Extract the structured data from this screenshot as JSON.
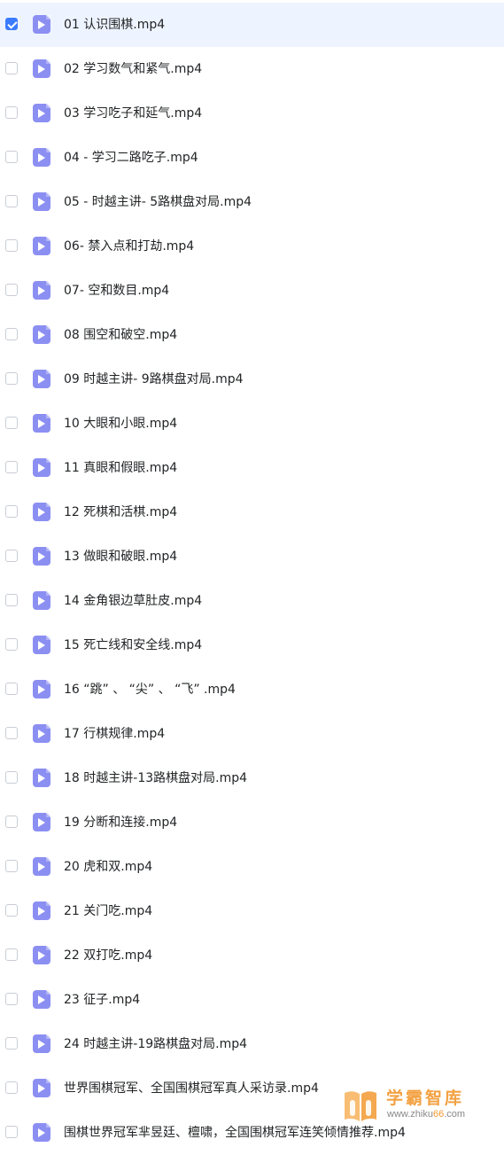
{
  "files": [
    {
      "name": "01 认识围棋.mp4",
      "checked": true
    },
    {
      "name": "02  学习数气和紧气.mp4",
      "checked": false
    },
    {
      "name": "03  学习吃子和延气.mp4",
      "checked": false
    },
    {
      "name": "04 - 学习二路吃子.mp4",
      "checked": false
    },
    {
      "name": "05 - 时越主讲- 5路棋盘对局.mp4",
      "checked": false
    },
    {
      "name": "06- 禁入点和打劫.mp4",
      "checked": false
    },
    {
      "name": "07- 空和数目.mp4",
      "checked": false
    },
    {
      "name": "08  围空和破空.mp4",
      "checked": false
    },
    {
      "name": "09  时越主讲- 9路棋盘对局.mp4",
      "checked": false
    },
    {
      "name": "10  大眼和小眼.mp4",
      "checked": false
    },
    {
      "name": "11 真眼和假眼.mp4",
      "checked": false
    },
    {
      "name": "12 死棋和活棋.mp4",
      "checked": false
    },
    {
      "name": "13  做眼和破眼.mp4",
      "checked": false
    },
    {
      "name": "14 金角银边草肚皮.mp4",
      "checked": false
    },
    {
      "name": "15 死亡线和安全线.mp4",
      "checked": false
    },
    {
      "name": "16  “跳” 、 “尖” 、 “飞” .mp4",
      "checked": false
    },
    {
      "name": "17  行棋规律.mp4",
      "checked": false
    },
    {
      "name": "18  时越主讲-13路棋盘对局.mp4",
      "checked": false
    },
    {
      "name": "19  分断和连接.mp4",
      "checked": false
    },
    {
      "name": "20  虎和双.mp4",
      "checked": false
    },
    {
      "name": "21  关门吃.mp4",
      "checked": false
    },
    {
      "name": "22  双打吃.mp4",
      "checked": false
    },
    {
      "name": "23  征子.mp4",
      "checked": false
    },
    {
      "name": "24  时越主讲-19路棋盘对局.mp4",
      "checked": false
    },
    {
      "name": "世界围棋冠军、全国围棋冠军真人采访录.mp4",
      "checked": false
    },
    {
      "name": "围棋世界冠军芈昱廷、檀啸，全国围棋冠军连笑倾情推荐.mp4",
      "checked": false
    }
  ],
  "icons": {
    "checkbox": "checkbox-icon",
    "file": "video-file-icon"
  },
  "colors": {
    "accent": "#3a7bfd",
    "selected_row": "#eef4ff",
    "file_icon": "#8c8ff2",
    "watermark": "#f29a33"
  },
  "watermark": {
    "title": "学霸智库",
    "url_prefix": "www.zhiku",
    "url_highlight": "66",
    "url_suffix": ".com"
  }
}
